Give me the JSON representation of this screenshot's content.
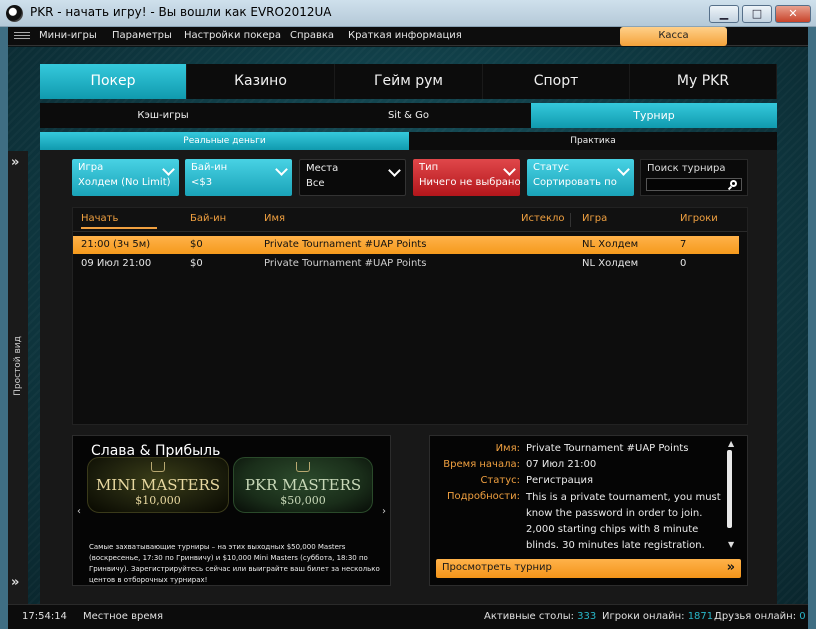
{
  "window": {
    "title": "PKR - начать игру! - Вы вошли как EVRO2012UA",
    "btn_min": "▁",
    "btn_max": "□",
    "btn_close": "✕"
  },
  "menubar": {
    "items": [
      "Мини-игры",
      "Параметры",
      "Настройки покера",
      "Справка",
      "Краткая информация"
    ],
    "cashier": "Касса"
  },
  "sidebar": {
    "label": "Простой вид",
    "arrow": "»"
  },
  "main_tabs": [
    "Покер",
    "Казино",
    "Гейм рум",
    "Спорт",
    "My PKR"
  ],
  "main_tab_active": "Покер",
  "sub_tabs": [
    "Кэш-игры",
    "Sit & Go",
    "Турнир"
  ],
  "sub_tab_active": "Турнир",
  "money_tabs": [
    "Реальные деньги",
    "Практика"
  ],
  "money_tab_active": "Реальные деньги",
  "filters": [
    {
      "label": "Игра",
      "value": "Холдем (No Limit)",
      "style": "teal"
    },
    {
      "label": "Бай-ин",
      "value": "<$3",
      "style": "teal"
    },
    {
      "label": "Места",
      "value": "Все",
      "style": "dark"
    },
    {
      "label": "Тип",
      "value": "Ничего не выбрано",
      "style": "red"
    },
    {
      "label": "Статус",
      "value": "Сортировать по",
      "style": "teal"
    }
  ],
  "search": {
    "label": "Поиск турнира",
    "placeholder": ""
  },
  "table": {
    "columns": [
      "Начать",
      "Бай-ин",
      "Имя",
      "Истекло",
      "Игра",
      "Игроки"
    ],
    "sorted_column": "Начать",
    "rows": [
      {
        "start": "21:00 (3ч 5м)",
        "buyin": "$0",
        "name": "Private Tournament #UAP Points",
        "elapsed": "",
        "game": "NL Холдем",
        "players": "7",
        "selected": true
      },
      {
        "start": "09 Июл 21:00",
        "buyin": "$0",
        "name": "Private Tournament #UAP Points",
        "elapsed": "",
        "game": "NL Холдем",
        "players": "0",
        "selected": false
      }
    ]
  },
  "promo": {
    "title": "Слава & Прибыль",
    "badges": [
      {
        "title": "MINI MASTERS",
        "value": "$10,000"
      },
      {
        "title": "PKR MASTERS",
        "value": "$50,000"
      }
    ],
    "arrow_left": "‹",
    "arrow_right": "›",
    "text": "Самые захватывающие турниры – на этих выходных $50,000 Masters (воскресенье, 17:30 по Гринвичу) и $10,000 Mini Masters (суббота, 18:30 по Гринвичу). Зарегистрируйтесь сейчас или выиграйте ваш билет за несколько центов в отборочных турнирах!"
  },
  "details": {
    "name_label": "Имя:",
    "name_value": "Private Tournament #UAP Points",
    "start_label": "Время начала:",
    "start_value": "07 Июл 21:00",
    "status_label": "Статус:",
    "status_value": "Регистрация",
    "details_label": "Подробности:",
    "details_value": "This is a private tournament, you must know the password in order to join. 2,000 starting chips with 8 minute blinds. 30 minutes late registration.",
    "view_button": "Просмотреть турнир",
    "view_arrow": "»"
  },
  "statusbar": {
    "time": "17:54:14",
    "time_label": "Местное время",
    "active_tables_label": "Активные столы:",
    "active_tables": "333",
    "players_online_label": "Игроки онлайн:",
    "players_online": "1871",
    "friends_online_label": "Друзья онлайн:",
    "friends_online": "0"
  },
  "colors": {
    "accent_teal": "#1aa3b8",
    "accent_orange": "#f59a1c",
    "accent_red": "#b3161b",
    "number_blue": "#29b6c8"
  }
}
